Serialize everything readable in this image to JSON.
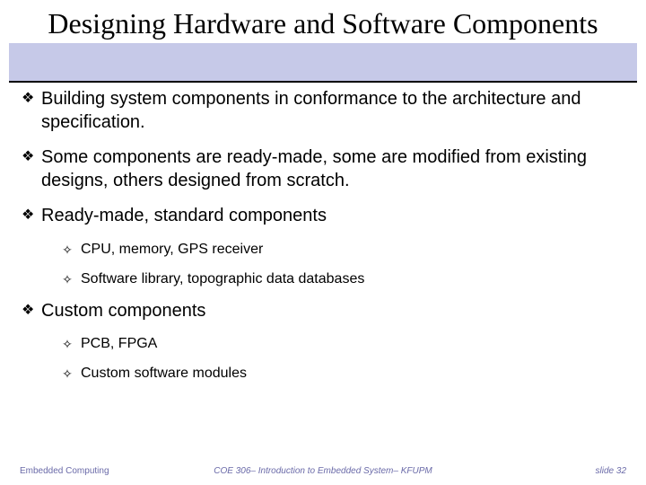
{
  "title": "Designing Hardware and Software Components",
  "bullets": [
    {
      "text": "Building system components in conformance to the architecture and specification."
    },
    {
      "text": "Some components are ready-made,  some are modified from existing designs, others designed from scratch."
    },
    {
      "text": "Ready-made, standard components",
      "subs": [
        "CPU, memory, GPS receiver",
        "Software library, topographic data databases"
      ]
    },
    {
      "text": "Custom components",
      "subs": [
        "PCB, FPGA",
        "Custom software modules"
      ]
    }
  ],
  "footer": {
    "left": "Embedded Computing",
    "center": "COE 306– Introduction to Embedded System– KFUPM",
    "right": "slide 32"
  },
  "glyphs": {
    "diamond": "❖",
    "cross": "✧"
  }
}
